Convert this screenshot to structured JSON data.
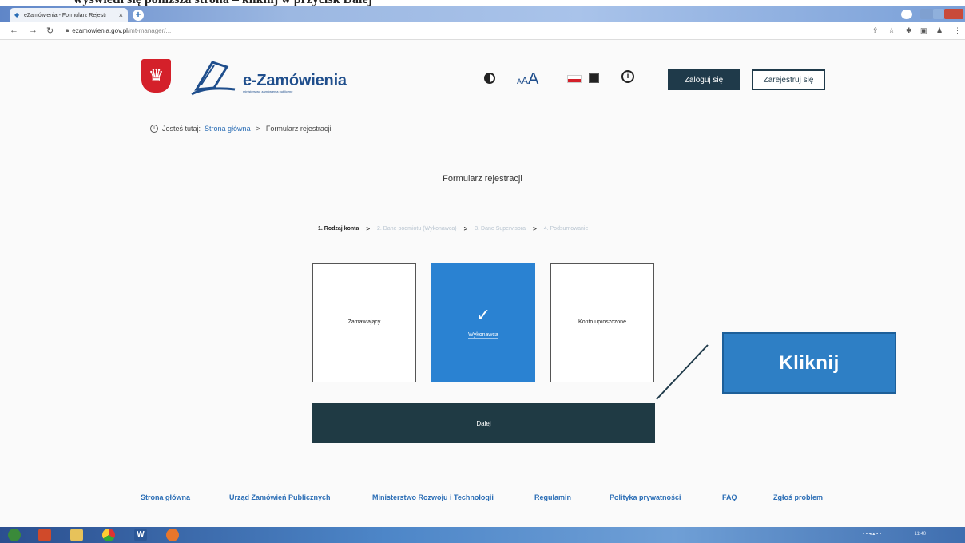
{
  "instruction": {
    "text": "wyświetli się poniższa strona – kliknij w przycisk Dalej"
  },
  "browser": {
    "tab_title": "eZamówienia - Formularz Rejestr",
    "tab_close": "×",
    "new_tab": "+",
    "url_host": "ezamowienia.gov.pl",
    "url_path": "/mt-manager/..."
  },
  "header": {
    "brand": "e-Zamówienia",
    "brand_sub": "ministerstwo zamówienia publiczne",
    "font_small": "A",
    "font_mid": "A",
    "font_large": "A",
    "info": "i",
    "login_label": "Zaloguj się",
    "register_label": "Zarejestruj się"
  },
  "breadcrumb": {
    "icon": "i",
    "prefix": "Jesteś tutaj:",
    "home": "Strona główna",
    "separator": ">",
    "current": "Formularz rejestracji"
  },
  "form": {
    "title": "Formularz rejestracji",
    "steps": [
      {
        "label": "1. Rodzaj konta",
        "active": true
      },
      {
        "label": "2. Dane podmiotu (Wykonawca)",
        "active": false
      },
      {
        "label": "3. Dane Supervisora",
        "active": false
      },
      {
        "label": "4. Podsumowanie",
        "active": false
      }
    ],
    "step_separator": ">",
    "cards": [
      {
        "label": "Zamawiający",
        "selected": false
      },
      {
        "label": "Wykonawca",
        "selected": true
      },
      {
        "label": "Konto uproszczone",
        "selected": false
      }
    ],
    "check": "✓",
    "next_label": "Dalej"
  },
  "callout": {
    "label": "Kliknij"
  },
  "footer": {
    "links": [
      "Strona główna",
      "Urząd Zamówień Publicznych",
      "Ministerstwo Rozwoju i Technologii",
      "Regulamin",
      "Polityka prywatności",
      "FAQ",
      "Zgłoś problem"
    ]
  },
  "taskbar": {
    "apps": [
      "start-orb-icon",
      "media-icon",
      "explorer-icon",
      "chrome-icon",
      "word-icon",
      "firefox-icon"
    ],
    "word_letter": "W",
    "clock": "11:40"
  },
  "colors": {
    "brand_blue": "#1f4e8c",
    "selected_card": "#2a82d2",
    "dark_button": "#1f3a44",
    "callout": "#2e7fc5",
    "link": "#2a6db5"
  }
}
